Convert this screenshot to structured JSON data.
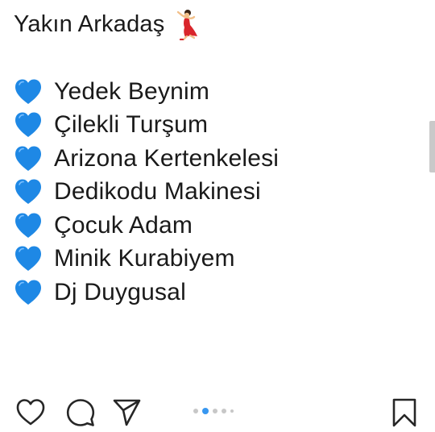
{
  "post": {
    "title": "Yakın Arkadaş",
    "title_emoji": "dancer-icon",
    "items": [
      "Yedek Beynim",
      "Çilekli Turşum",
      "Arizona Kertenkelesi",
      "Dedikodu Makinesi",
      "Çocuk Adam",
      "Minik Kurabiyem",
      "Dj Duygusal"
    ],
    "bullet_icon": "blue-heart-icon"
  },
  "action_bar": {
    "icons": [
      "heart-outline-icon",
      "comment-icon",
      "share-icon",
      "bookmark-icon"
    ],
    "carousel": {
      "total": 5,
      "active_index": 1
    }
  },
  "colors": {
    "heart_blue": "#1E88E5",
    "active_dot": "#3897f0",
    "text": "#1a1a1a",
    "dancer_red": "#d9262c"
  }
}
